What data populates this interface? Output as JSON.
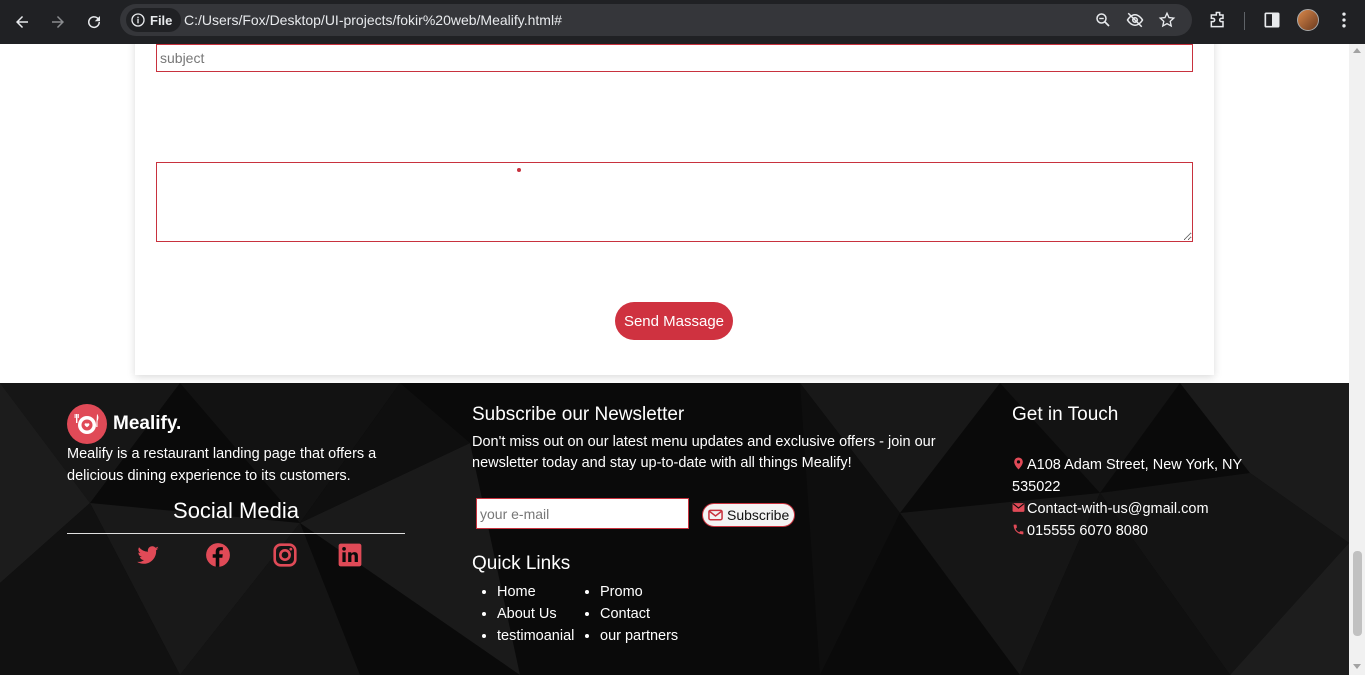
{
  "browser": {
    "chip_label": "File",
    "url": "C:/Users/Fox/Desktop/UI-projects/fokir%20web/Mealify.html#",
    "icons": [
      "back-icon",
      "forward-icon",
      "reload-icon",
      "info-icon",
      "zoom-icon",
      "eye-off-icon",
      "star-icon",
      "extensions-icon",
      "sidebar-icon",
      "profile-avatar",
      "more-icon"
    ]
  },
  "contact_form": {
    "subject_placeholder": "subject",
    "message_value": "",
    "send_button_label": "Send Massage"
  },
  "footer": {
    "brand": {
      "name": "Mealify.",
      "description": "Mealify is a restaurant landing page that offers a delicious dining experience to its customers."
    },
    "social": {
      "title": "Social Media",
      "icons": [
        "twitter-icon",
        "facebook-icon",
        "instagram-icon",
        "linkedin-icon"
      ]
    },
    "newsletter": {
      "title": "Subscribe our Newsletter",
      "description": "Don't miss out on our latest menu updates and exclusive offers - join our newsletter today and stay up-to-date with all things Mealify!",
      "email_placeholder": "your e-mail",
      "subscribe_label": "Subscribe"
    },
    "quick_links": {
      "title": "Quick Links",
      "col1": [
        "Home",
        "About Us",
        "testimoanial"
      ],
      "col2": [
        "Promo",
        "Contact",
        "our partners"
      ]
    },
    "get_in_touch": {
      "title": "Get in Touch",
      "address": "A108 Adam Street, New York, NY 535022",
      "email": "Contact-with-us@gmail.com",
      "phone": "015555 6070 8080"
    }
  },
  "colors": {
    "accent": "#cf3240",
    "footer_bg": "#0a0a0a",
    "chrome_bg": "#202124"
  }
}
